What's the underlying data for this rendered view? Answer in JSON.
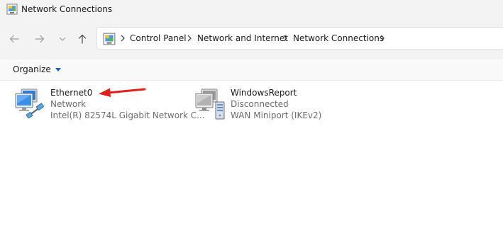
{
  "window": {
    "title": "Network Connections"
  },
  "breadcrumb": {
    "items": [
      {
        "label": "Control Panel"
      },
      {
        "label": "Network and Internet"
      },
      {
        "label": "Network Connections"
      }
    ]
  },
  "toolbar": {
    "organize_label": "Organize"
  },
  "connections": [
    {
      "name": "Ethernet0",
      "status": "Network",
      "device": "Intel(R) 82574L Gigabit Network C..."
    },
    {
      "name": "WindowsReport",
      "status": "Disconnected",
      "device": "WAN Miniport (IKEv2)"
    }
  ],
  "icons": {
    "title": "control-panel-icon",
    "back": "arrow-left-icon",
    "forward": "arrow-right-icon",
    "recent": "chevron-down-icon",
    "up": "arrow-up-icon",
    "separator": "chevron-right-icon",
    "ethernet": "ethernet-adapter-icon",
    "vpn": "vpn-connection-icon",
    "annotation": "red-arrow-annotation"
  },
  "colors": {
    "chrome_bg": "#f3f3f3",
    "commandbar_bg": "#f9f9f9",
    "accent": "#1f5fbf",
    "secondary_text": "#6d6d6d",
    "annotation_red": "#e0201b"
  }
}
